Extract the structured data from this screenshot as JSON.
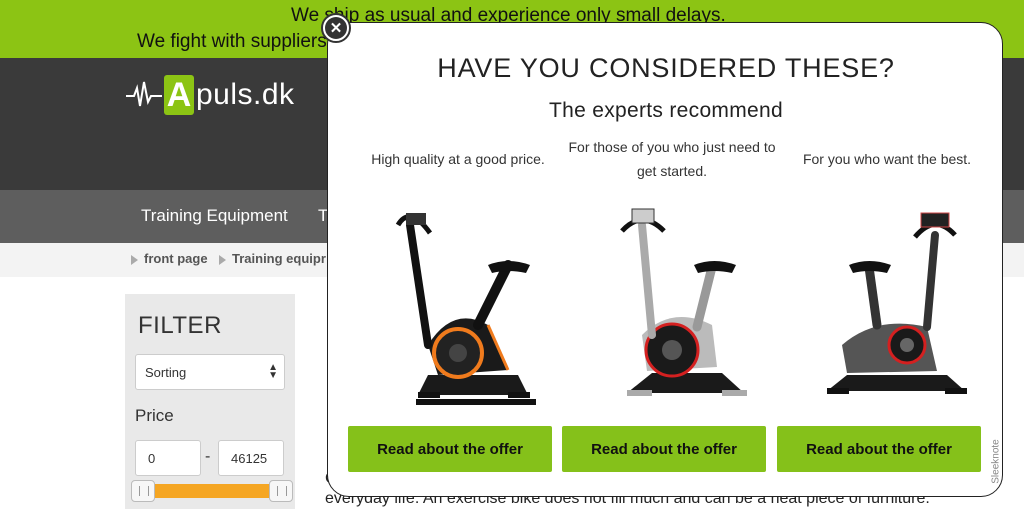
{
  "announcement": {
    "line1": "We ship as usual and experience only small delays.",
    "line2": "We fight with suppliers"
  },
  "logo": {
    "letter": "A",
    "rest": "puls.dk"
  },
  "nav": {
    "item1": "Training Equipment",
    "item2": "T"
  },
  "breadcrumb": {
    "item1": "front page",
    "item2": "Training equipr"
  },
  "filter": {
    "title": "FILTER",
    "sorting": "Sorting",
    "price_label": "Price",
    "price_min": "0",
    "price_max": "46125",
    "dash": "-"
  },
  "body_text": {
    "prefix": "C",
    "line": "everyday life. An exercise bike does not fill much and can be a neat piece of furniture."
  },
  "popup": {
    "title": "HAVE YOU CONSIDERED THESE?",
    "subtitle": "The experts recommend",
    "products": [
      {
        "description": "High quality at a good price.",
        "button": "Read about the offer",
        "accent": "#f07b1d"
      },
      {
        "description": "For those of you who just need to get started.",
        "button": "Read about the offer",
        "accent": "#d42020"
      },
      {
        "description": "For you who want the best.",
        "button": "Read about the offer",
        "accent": "#d42020"
      }
    ]
  },
  "sleeknote": "Sleeknote",
  "colors": {
    "brand_green": "#8cc414",
    "button_green": "#85c11a",
    "slider_orange": "#f5a623",
    "header_dark": "#3a3a3a"
  },
  "icons": {
    "close": "close-icon",
    "breadcrumb": "triangle-right-icon",
    "select": "updown-arrows-icon"
  }
}
